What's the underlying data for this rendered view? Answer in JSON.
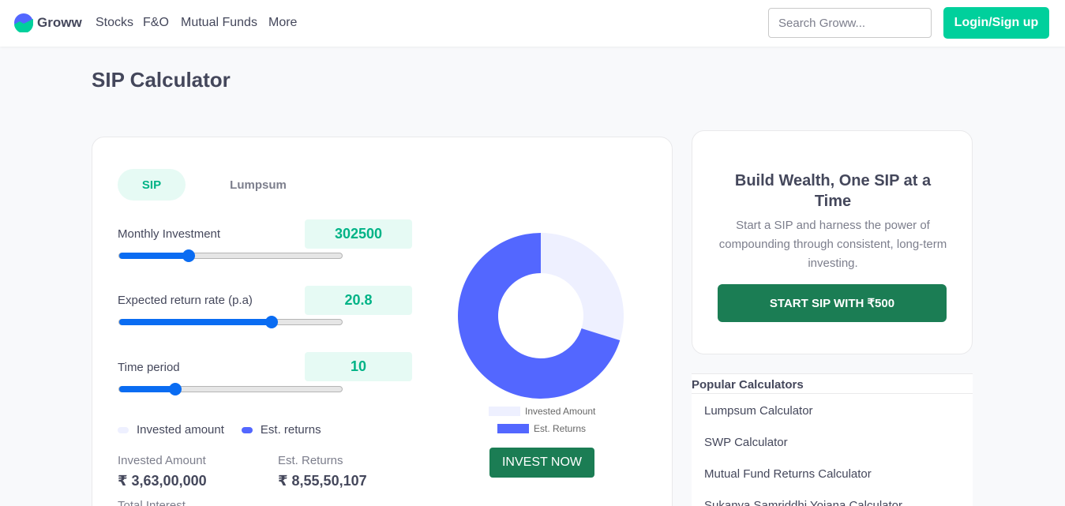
{
  "header": {
    "brand": "Groww",
    "nav": [
      "Stocks",
      "F&O",
      "Mutual Funds",
      "More"
    ],
    "search_placeholder": "Search Groww...",
    "login_label": "Login/Sign up"
  },
  "page_title": "SIP Calculator",
  "calculator": {
    "tabs": [
      "SIP",
      "Lumpsum"
    ],
    "fields": [
      {
        "label": "Monthly Investment",
        "value": "302500",
        "fill": 0.31
      },
      {
        "label": "Expected return rate (p.a)",
        "value": "20.8",
        "fill": 0.68
      },
      {
        "label": "Time period",
        "value": "10",
        "fill": 0.25
      }
    ],
    "legend": [
      "Invested amount",
      "Est. returns"
    ],
    "invested_label": "Invested Amount",
    "invested_value": "₹ 3,63,00,000",
    "returns_label": "Est. Returns",
    "returns_value": "₹ 8,55,50,107",
    "total_label": "Total Interest",
    "invest_now": "INVEST NOW"
  },
  "chart_data": {
    "type": "pie",
    "categories": [
      "Invested Amount",
      "Est. Returns"
    ],
    "values": [
      36300000,
      85550107
    ],
    "colors": [
      "#eef0ff",
      "#5367ff"
    ],
    "legend_position": "bottom"
  },
  "colors": {
    "accent": "#00d09c",
    "button_dark": "#1b7d54",
    "slider": "#0a6cf2",
    "returns": "#5367ff",
    "invested": "#eef0ff"
  },
  "promo": {
    "title": "Build Wealth, One SIP at a Time",
    "text": "Start a SIP and harness the power of compounding through consistent, long-term investing.",
    "button": "START SIP WITH ₹500"
  },
  "popular": {
    "title": "Popular Calculators",
    "items": [
      "Lumpsum Calculator",
      "SWP Calculator",
      "Mutual Fund Returns Calculator",
      "Sukanya Samriddhi Yojana Calculator"
    ]
  }
}
